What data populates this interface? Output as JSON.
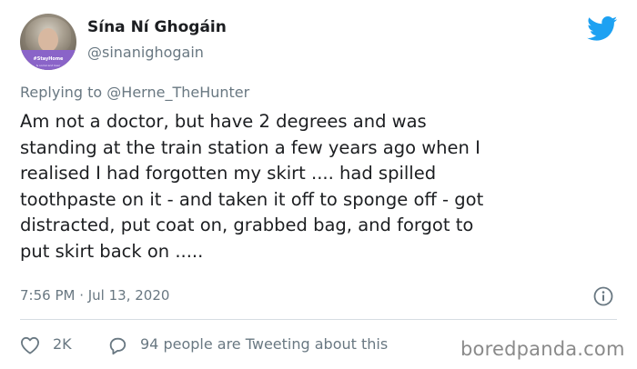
{
  "author": {
    "name": "Sína Ní Ghogáin",
    "handle": "@sinanighogain",
    "avatar_frame_text": "#StayHome",
    "avatar_frame_subtext": "& social and beer"
  },
  "reply": {
    "prefix": "Replying to",
    "mention": "@Herne_TheHunter"
  },
  "tweet": {
    "lines": [
      "Am not a doctor, but have 2 degrees and was",
      "standing at the train station a few years ago when I",
      "realised I had forgotten my skirt .... had spilled",
      "toothpaste on it - and taken it off to sponge off - got",
      "distracted, put coat on, grabbed bag, and forgot to",
      "put skirt back on ....."
    ],
    "timestamp": "7:56 PM · Jul 13, 2020"
  },
  "actions": {
    "like_count": "2K",
    "conversation_text": "94 people are Tweeting about this"
  },
  "watermark": "boredpanda.com",
  "colors": {
    "twitter_blue": "#1da1f2",
    "secondary_text": "#697882",
    "primary_text": "#1c1e21",
    "divider": "#d6dde2"
  },
  "icons": {
    "brand": "twitter-bird-icon",
    "info": "info-icon",
    "like": "heart-icon",
    "reply": "speech-bubble-icon"
  }
}
